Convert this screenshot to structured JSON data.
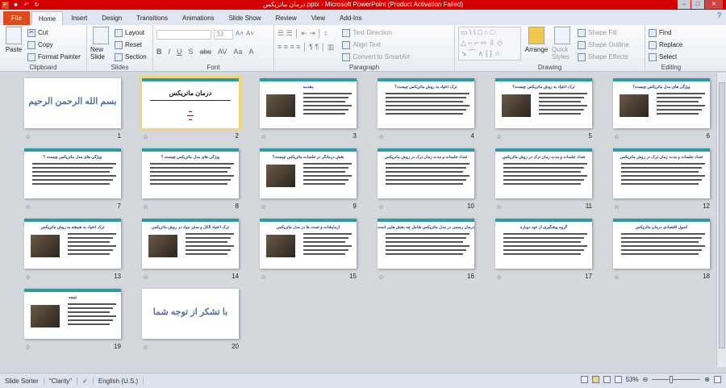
{
  "window": {
    "title": "درمان ماتریکس.pptx - Microsoft PowerPoint (Product Activation Failed)"
  },
  "tabs": [
    "File",
    "Home",
    "Insert",
    "Design",
    "Transitions",
    "Animations",
    "Slide Show",
    "Review",
    "View",
    "Add-Ins"
  ],
  "ribbon": {
    "clipboard": {
      "label": "Clipboard",
      "paste": "Paste",
      "cut": "Cut",
      "copy": "Copy",
      "format_painter": "Format Painter"
    },
    "slides": {
      "label": "Slides",
      "new_slide": "New Slide",
      "layout": "Layout",
      "reset": "Reset",
      "section": "Section"
    },
    "font": {
      "label": "Font",
      "font_name": "",
      "font_size": "33"
    },
    "paragraph": {
      "label": "Paragraph",
      "text_direction": "Text Direction",
      "align_text": "Align Text",
      "convert_smartart": "Convert to SmartArt"
    },
    "drawing": {
      "label": "Drawing",
      "arrange": "Arrange",
      "quick_styles": "Quick Styles",
      "shape_fill": "Shape Fill",
      "shape_outline": "Shape Outline",
      "shape_effects": "Shape Effects"
    },
    "editing": {
      "label": "Editing",
      "find": "Find",
      "replace": "Replace",
      "select": "Select"
    }
  },
  "slides": [
    {
      "n": "1",
      "title": "بسم الله الرحمن الرحیم",
      "kind": "big"
    },
    {
      "n": "2",
      "title": "درمان ماتریکس",
      "kind": "cover",
      "selected": true
    },
    {
      "n": "3",
      "title": "مقدمه",
      "kind": "pic"
    },
    {
      "n": "4",
      "title": "ترک اعتیاد به روش ماتریکس چیست؟",
      "kind": "text"
    },
    {
      "n": "5",
      "title": "ترک اعتیاد به روش ماتریکس چیست؟",
      "kind": "pic"
    },
    {
      "n": "6",
      "title": "ویژگی های مدل ماتریکس چیست؟",
      "kind": "pic"
    },
    {
      "n": "7",
      "title": "ویژگی های مدل ماتریکس چیست ؟",
      "kind": "text"
    },
    {
      "n": "8",
      "title": "ویژگی های مدل ماتریکس چیست ؟",
      "kind": "text"
    },
    {
      "n": "9",
      "title": "نقش درمانگر در جلسات ماتریکس چیست؟",
      "kind": "pic"
    },
    {
      "n": "10",
      "title": "تعداد جلسات و مدت زمان ترک در روش ماتریکس",
      "kind": "text"
    },
    {
      "n": "11",
      "title": "تعداد جلسات و مدت زمان ترک در روش ماتریکس",
      "kind": "text"
    },
    {
      "n": "12",
      "title": "تعداد جلسات و مدت زمان ترک در روش ماتریکس",
      "kind": "text"
    },
    {
      "n": "13",
      "title": "ترک اعتیاد به شیشه به روش ماتریکس",
      "kind": "pic"
    },
    {
      "n": "14",
      "title": "ترک اعتیاد الکل و سایر مواد در روش ماتریکس",
      "kind": "pic"
    },
    {
      "n": "15",
      "title": "آزمایشات و تست ها در مدل ماتریکس",
      "kind": "pic"
    },
    {
      "n": "16",
      "title": "درمان رسمی در مدل ماتریکس شامل چه بخش هایی است؟",
      "kind": "text"
    },
    {
      "n": "17",
      "title": "گروه پیشگیری از عود دوباره",
      "kind": "text"
    },
    {
      "n": "18",
      "title": "اصول اقتصادی درمان ماتریکس",
      "kind": "text"
    },
    {
      "n": "19",
      "title": "نتیجه",
      "kind": "pic"
    },
    {
      "n": "20",
      "title": "با تشکر از توجه شما",
      "kind": "big"
    }
  ],
  "status": {
    "view": "Slide Sorter",
    "theme": "\"Clarity\"",
    "language": "English (U.S.)",
    "zoom": "53%"
  }
}
